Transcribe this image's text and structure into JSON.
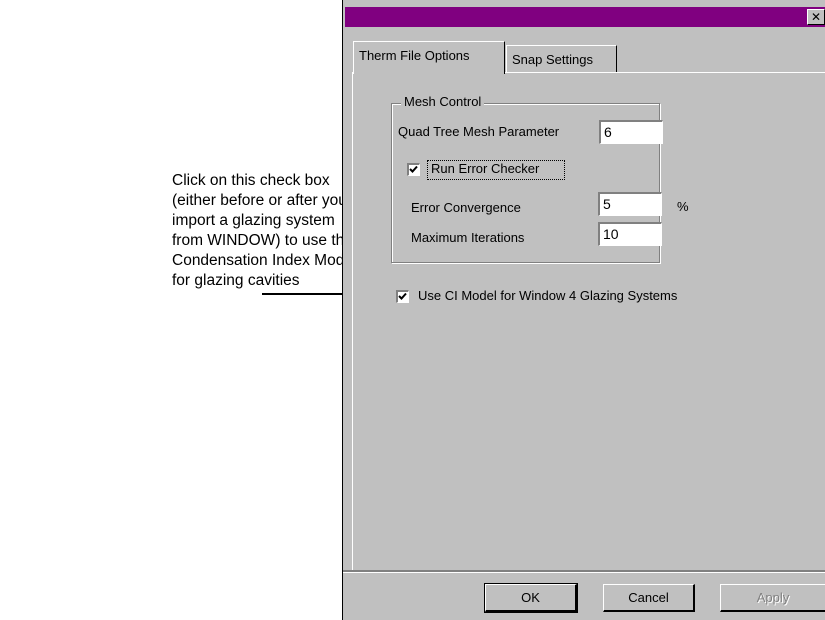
{
  "annotation": {
    "lines": [
      "Click on this check box",
      "(either before or after you",
      "import a glazing system",
      "from WINDOW) to use the",
      "Condensation Index Model",
      "for glazing cavities"
    ]
  },
  "dialog": {
    "title": "",
    "close_glyph": "✕",
    "tabs": [
      {
        "label": "Therm File Options",
        "active": true
      },
      {
        "label": "Snap Settings",
        "active": false
      }
    ],
    "mesh_control": {
      "legend": "Mesh Control",
      "quad_tree_label": "Quad Tree Mesh Parameter",
      "quad_tree_value": "6",
      "run_error_checker_label": "Run Error Checker",
      "run_error_checker_checked": true,
      "error_convergence_label": "Error Convergence",
      "error_convergence_value": "5",
      "error_convergence_unit": "%",
      "max_iterations_label": "Maximum Iterations",
      "max_iterations_value": "10"
    },
    "ci_model": {
      "label": "Use CI Model for Window 4 Glazing Systems",
      "checked": true
    },
    "buttons": {
      "ok": "OK",
      "cancel": "Cancel",
      "apply": "Apply"
    }
  },
  "colors": {
    "title_bar": "#800080",
    "dialog_face": "#c0c0c0"
  }
}
